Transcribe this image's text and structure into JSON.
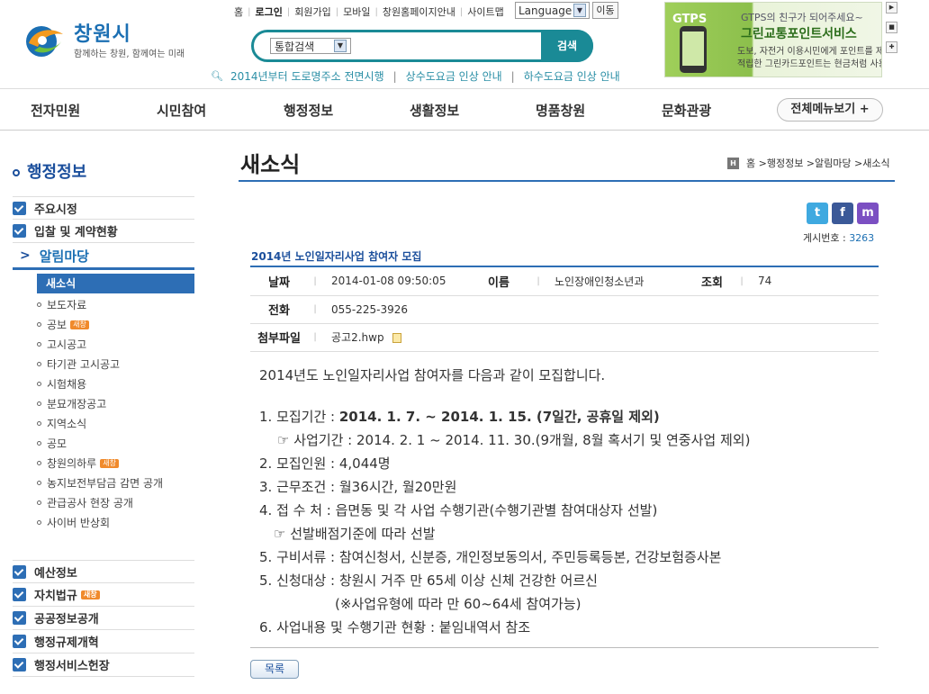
{
  "brand": {
    "name": "창원시",
    "slogan": "함께하는 창원, 함께여는 미래"
  },
  "topnav": [
    "홈",
    "로그인",
    "회원가입",
    "모바일",
    "창원홈페이지안내",
    "사이트맵"
  ],
  "language": {
    "label": "Language",
    "go": "이동"
  },
  "search": {
    "scope": "통합검색",
    "button": "검색"
  },
  "notices": [
    "2014년부터 도로명주소 전면시행",
    "상수도요금 인상 안내",
    "하수도요금 인상 안내"
  ],
  "banner": {
    "badge": "GTPS",
    "line1": "GTPS의 친구가 되어주세요~",
    "line2": "그린교통포인트서비스",
    "line3": "도보, 자전거 이용시민에게 포인트를 제공~",
    "line4": "적립한 그린카드포인트는 현금처럼 사용~"
  },
  "gnb": [
    "전자민원",
    "시민참여",
    "행정정보",
    "생활정보",
    "명품창원",
    "문화관광"
  ],
  "allmenu": "전체메뉴보기 +",
  "lnb": {
    "title": "행정정보",
    "top": [
      "주요시정",
      "입찰 및 계약현황"
    ],
    "active": "알림마당",
    "sub_selected": "새소식",
    "sub": [
      {
        "label": "보도자료",
        "new": ""
      },
      {
        "label": "공보",
        "new": "새창"
      },
      {
        "label": "고시공고",
        "new": ""
      },
      {
        "label": "타기관 고시공고",
        "new": ""
      },
      {
        "label": "시험채용",
        "new": ""
      },
      {
        "label": "분묘개장공고",
        "new": ""
      },
      {
        "label": "지역소식",
        "new": ""
      },
      {
        "label": "공모",
        "new": ""
      },
      {
        "label": "창원의하루",
        "new": "새창"
      },
      {
        "label": "농지보전부담금 감면 공개",
        "new": ""
      },
      {
        "label": "관급공사 현장 공개",
        "new": ""
      },
      {
        "label": "사이버 반상회",
        "new": ""
      }
    ],
    "bottom": [
      {
        "label": "예산정보",
        "new": ""
      },
      {
        "label": "자치법규",
        "new": "새창"
      },
      {
        "label": "공공정보공개",
        "new": ""
      },
      {
        "label": "행정규제개혁",
        "new": ""
      },
      {
        "label": "행정서비스헌장",
        "new": ""
      }
    ]
  },
  "page": {
    "title": "새소식",
    "breadcrumb": "홈 >행정정보 >알림마당 >새소식"
  },
  "social": {
    "twitter": "t",
    "facebook": "f",
    "me2day": "m"
  },
  "post": {
    "no_label": "게시번호 :",
    "no": "3263",
    "title": "2014년 노인일자리사업 참여자 모집",
    "date_label": "날짜",
    "date": "2014-01-08 09:50:05",
    "name_label": "이름",
    "name": "노인장애인청소년과",
    "views_label": "조회",
    "views": "74",
    "phone_label": "전화",
    "phone": "055-225-3926",
    "file_label": "첨부파일",
    "file": "공고2.hwp"
  },
  "content": {
    "intro": "2014년도 노인일자리사업 참여자를 다음과 같이 모집합니다.",
    "l1_a": "1. 모집기간 : ",
    "l1_b": "2014. 1. 7. ~ 2014. 1. 15. (7일간, 공휴일 제외)",
    "l1_sub": "☞ 사업기간 : 2014. 2. 1 ~ 2014. 11. 30.(9개월, 8월 혹서기 및 연중사업 제외)",
    "l2": "2. 모집인원 : 4,044명",
    "l3": "3. 근무조건 : 월36시간, 월20만원",
    "l4": "4. 접 수 처 : 읍면동 및 각 사업 수행기관(수행기관별 참여대상자 선발)",
    "l4_sub": "☞ 선발배점기준에 따라 선발",
    "l5": "5. 구비서류 : 참여신청서, 신분증, 개인정보동의서, 주민등록등본, 건강보험증사본",
    "l6": "5. 신청대상 : 창원시 거주 만 65세 이상 신체 건강한 어르신",
    "l6_sub": "(※사업유형에 따라 만 60~64세 참여가능)",
    "l7": "6. 사업내용 및 수행기관 현황  : 붙임내역서 참조"
  },
  "list_button": "목록"
}
